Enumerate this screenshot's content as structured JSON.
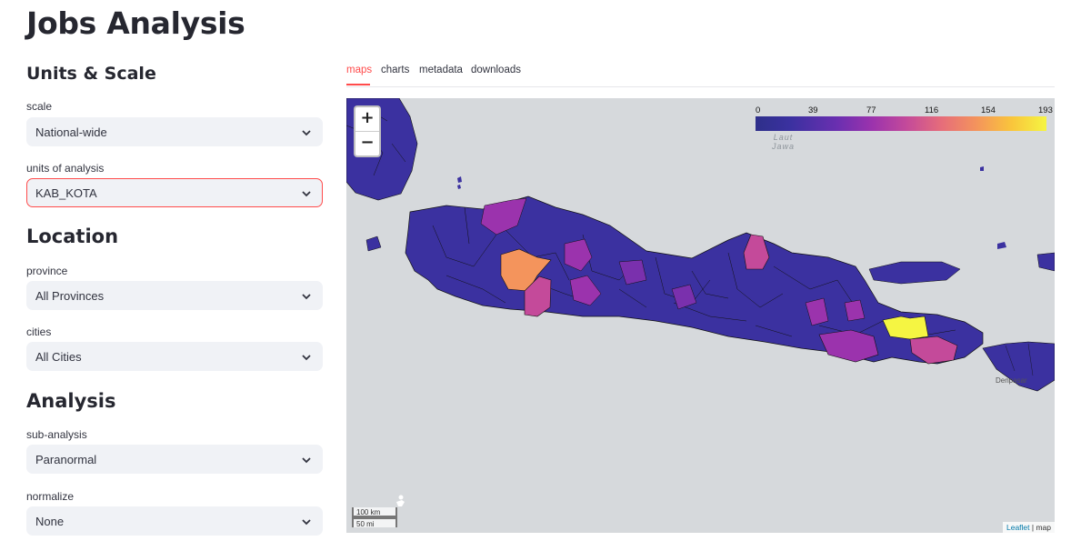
{
  "page": {
    "title": "Jobs Analysis"
  },
  "sidebar": {
    "units_scale": {
      "heading": "Units & Scale",
      "scale": {
        "label": "scale",
        "value": "National-wide"
      },
      "units": {
        "label": "units of analysis",
        "value": "KAB_KOTA"
      }
    },
    "location": {
      "heading": "Location",
      "province": {
        "label": "province",
        "value": "All Provinces"
      },
      "cities": {
        "label": "cities",
        "value": "All Cities"
      }
    },
    "analysis": {
      "heading": "Analysis",
      "sub_analysis": {
        "label": "sub-analysis",
        "value": "Paranormal"
      },
      "normalize": {
        "label": "normalize",
        "value": "None"
      }
    }
  },
  "tabs": [
    {
      "label": "maps",
      "active": true
    },
    {
      "label": "charts",
      "active": false
    },
    {
      "label": "metadata",
      "active": false
    },
    {
      "label": "downloads",
      "active": false
    }
  ],
  "map": {
    "zoom_in": "+",
    "zoom_out": "−",
    "legend_ticks": [
      "0",
      "39",
      "77",
      "116",
      "154",
      "193"
    ],
    "sea_labels": {
      "laut_java_line1": "Laut",
      "laut_java_line2": "Jawa"
    },
    "city_labels": {
      "denpasar": "Denpasar"
    },
    "scale": {
      "km": "100 km",
      "mi": "50 mi"
    },
    "attribution": {
      "link": "Leaflet",
      "rest": " | map"
    },
    "colors": {
      "base": "#3b31a0",
      "purple": "#9b33ad",
      "magenta": "#c44a9a",
      "orange": "#f4945c",
      "pink": "#e66d7a",
      "yellow": "#f5f542",
      "sea": "#d6d9dc",
      "land_grey": "#e3e3e3"
    }
  },
  "accent": "#ff4b4b"
}
